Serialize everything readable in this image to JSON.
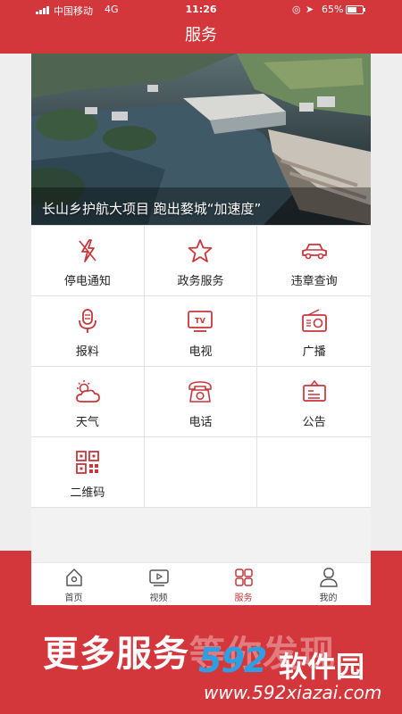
{
  "status_bar": {
    "carrier": "中国移动",
    "network": "4G",
    "time": "11:26",
    "battery": "65%",
    "battery_level": 0.65
  },
  "header": {
    "title": "服务"
  },
  "banner": {
    "caption": "长山乡护航大项目 跑出婺城“加速度”"
  },
  "services": [
    {
      "label": "停电通知",
      "icon": "power-outage-icon"
    },
    {
      "label": "政务服务",
      "icon": "star-icon"
    },
    {
      "label": "违章查询",
      "icon": "car-icon"
    },
    {
      "label": "报料",
      "icon": "microphone-icon"
    },
    {
      "label": "电视",
      "icon": "tv-icon"
    },
    {
      "label": "广播",
      "icon": "radio-icon"
    },
    {
      "label": "天气",
      "icon": "weather-icon"
    },
    {
      "label": "电话",
      "icon": "telephone-icon"
    },
    {
      "label": "公告",
      "icon": "notice-board-icon"
    },
    {
      "label": "二维码",
      "icon": "qr-code-icon"
    }
  ],
  "tabs": [
    {
      "label": "首页",
      "icon": "home-icon",
      "active": false
    },
    {
      "label": "视频",
      "icon": "video-icon",
      "active": false
    },
    {
      "label": "服务",
      "icon": "grid-icon",
      "active": true
    },
    {
      "label": "我的",
      "icon": "user-icon",
      "active": false
    }
  ],
  "promo": {
    "text_main": "更多服务",
    "text_faded": "等你发现"
  },
  "watermark": {
    "brand": "592",
    "name": "软件园",
    "url": "www.592xiazai.com"
  },
  "colors": {
    "brand_red": "#d3363b",
    "icon_red": "#c7363a"
  }
}
